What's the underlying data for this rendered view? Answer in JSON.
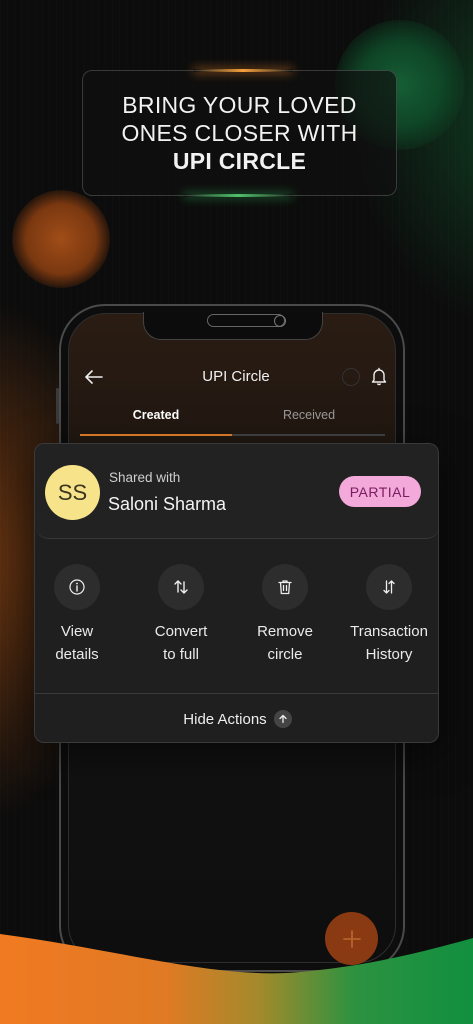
{
  "headline": {
    "line1": "BRING YOUR LOVED",
    "line2": "ONES CLOSER WITH",
    "line3": "UPI CIRCLE"
  },
  "app": {
    "title": "UPI Circle",
    "tabs": [
      {
        "label": "Created",
        "active": true
      },
      {
        "label": "Received",
        "active": false
      }
    ]
  },
  "circle_card": {
    "avatar_initials": "SS",
    "shared_with_label": "Shared with",
    "name": "Saloni Sharma",
    "status_badge": "PARTIAL",
    "actions": [
      {
        "label": "View\ndetails",
        "icon": "info-icon"
      },
      {
        "label": "Convert\nto full",
        "icon": "swap-arrows-icon"
      },
      {
        "label": "Remove\ncircle",
        "icon": "trash-icon"
      },
      {
        "label": "Transaction\nHistory",
        "icon": "history-arrows-icon"
      }
    ],
    "hide_actions_label": "Hide Actions"
  },
  "colors": {
    "accent_orange": "#e8822a",
    "accent_green": "#1f8f45",
    "badge_bg": "#f3a9d9",
    "avatar_bg": "#f6e38a"
  }
}
